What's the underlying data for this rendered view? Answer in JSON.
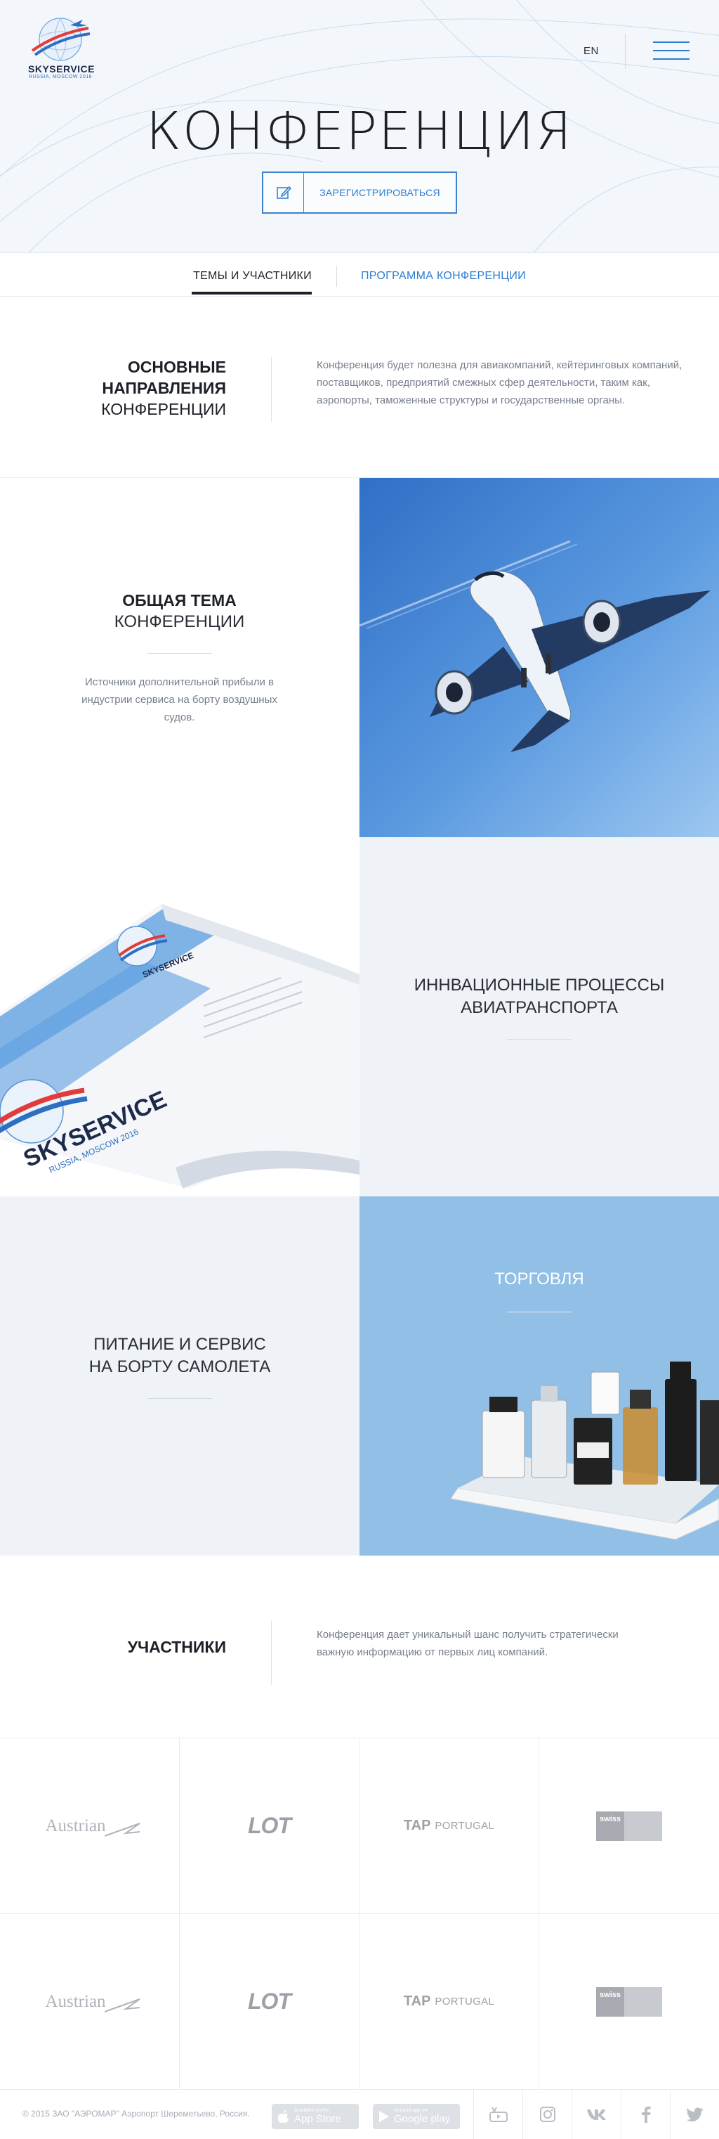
{
  "header": {
    "logo": {
      "text": "SKYSERVICE",
      "sub": "RUSSIA, MOSCOW 2016"
    },
    "lang": "EN",
    "menu_icon": "burger-menu-icon"
  },
  "hero": {
    "title": "КОНФЕРЕНЦИЯ",
    "register_label": "ЗАРЕГИСТРИРОВАТЬСЯ",
    "register_icon": "edit-icon"
  },
  "tabs": [
    {
      "label": "ТЕМЫ И УЧАСТНИКИ",
      "active": true
    },
    {
      "label": "ПРОГРАММА КОНФЕРЕНЦИИ",
      "active": false
    }
  ],
  "intro": {
    "title_bold_1": "ОСНОВНЫЕ",
    "title_bold_2": "НАПРАВЛЕНИЯ",
    "title_norm": "КОНФЕРЕНЦИИ",
    "text": "Конференция будет полезна для авиакомпаний, кейтеринговых компаний, поставщиков, предприятий смежных сфер деятельности, таким как, аэропорты, таможенные структуры и государственные органы."
  },
  "topics": {
    "general": {
      "title_bold": "ОБЩАЯ ТЕМА",
      "title_norm": "КОНФЕРЕНЦИИ",
      "text": "Источники дополнительной прибыли в индустрии сервиса на борту воздушных судов."
    },
    "innovation": {
      "line1": "ИННВАЦИОННЫЕ ПРОЦЕССЫ",
      "line2": "АВИАТРАНСПОРТА"
    },
    "food": {
      "line1": "ПИТАНИЕ И СЕРВИС",
      "line2": "НА БОРТУ САМОЛЕТА"
    },
    "trade": {
      "line1": "ТОРГОВЛЯ"
    },
    "brochure": {
      "logo_text": "SKYSERVICE",
      "logo_sub": "RUSSIA, MOSCOW 2016"
    }
  },
  "participants": {
    "title": "УЧАСТНИКИ",
    "text": "Конференция дает уникальный шанс получить стратегически важную информацию от первых лиц компаний.",
    "logos": [
      {
        "name": "Austrian"
      },
      {
        "name": "LOT"
      },
      {
        "name": "TAP",
        "sub": "PORTUGAL"
      },
      {
        "name": "swiss"
      },
      {
        "name": "Austrian"
      },
      {
        "name": "LOT"
      },
      {
        "name": "TAP",
        "sub": "PORTUGAL"
      },
      {
        "name": "swiss"
      }
    ]
  },
  "footer": {
    "copyright": "© 2015 ЗАО \"АЭРОМАР\" Аэропорт Шереметьево, Россия.",
    "appstore_small": "Available on the",
    "appstore_big": "App Store",
    "googleplay_small": "Android app on",
    "googleplay_big": "Google play",
    "social": [
      "youtube-icon",
      "instagram-icon",
      "vk-icon",
      "facebook-icon",
      "twitter-icon"
    ]
  },
  "colors": {
    "accent": "#2b7cd3",
    "light_bg": "#eff3f7",
    "blue_tile": "#91bfe5",
    "text_muted": "#767e8c"
  }
}
